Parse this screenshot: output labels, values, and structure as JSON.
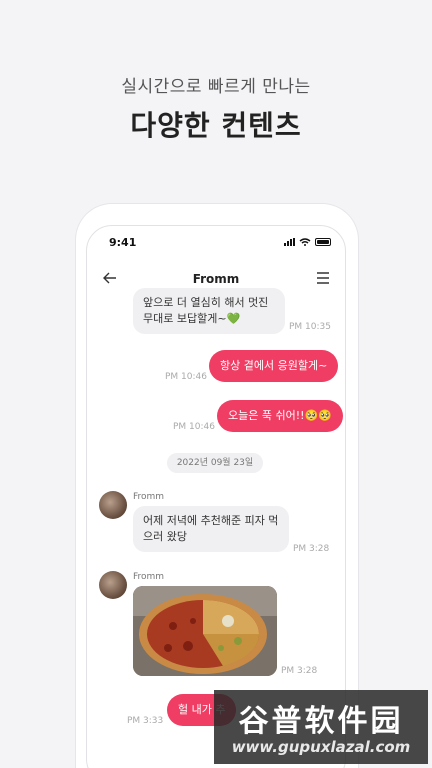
{
  "hero": {
    "subtitle": "실시간으로 빠르게 만나는",
    "title": "다양한 컨텐츠"
  },
  "status_bar": {
    "time": "9:41"
  },
  "chat": {
    "title": "Fromm",
    "messages": [
      {
        "type": "incoming",
        "text_line1": "앞으로 더 열심히 해서 멋진",
        "text_line2": "무대로 보답할게~💚",
        "time": "PM 10:35"
      },
      {
        "type": "outgoing",
        "text": "항상 곁에서 응원할게~",
        "time": "PM 10:46"
      },
      {
        "type": "outgoing",
        "text": "오늘은 푹 쉬어!!🥺🥺",
        "time": "PM 10:46"
      },
      {
        "type": "date",
        "text": "2022년 09월 23일"
      },
      {
        "type": "incoming",
        "sender": "Fromm",
        "text_line1": "어제 저녁에 추천해준 피자 먹",
        "text_line2": "으러 왔당",
        "time": "PM 3:28"
      },
      {
        "type": "incoming-photo",
        "sender": "Fromm",
        "time": "PM 3:28"
      },
      {
        "type": "outgoing",
        "text": "헐 내가 추",
        "time": "PM 3:33"
      }
    ]
  },
  "watermark": {
    "top": "谷普软件园",
    "bottom": "www.gupuxlazal.com"
  },
  "colors": {
    "accent": "#f03d63",
    "bubble_in": "#f0f0f2",
    "background": "#f4f4f6"
  }
}
